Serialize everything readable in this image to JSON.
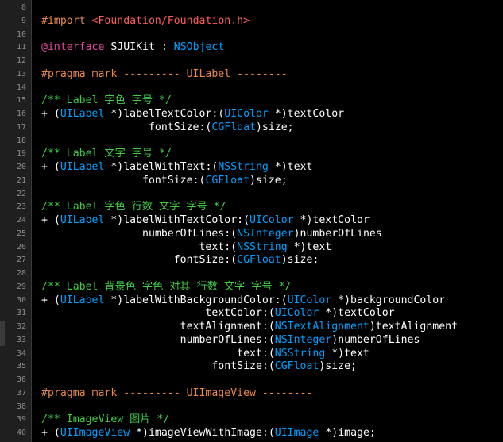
{
  "colors": {
    "background": "#000000",
    "gutter": "#1f1f1f",
    "gutter_text": "#8c8c8c",
    "plain": "#ffffff",
    "comment": "#41cc45",
    "preproc": "#e8884a",
    "string": "#ff5c5c",
    "keyword": "#e64aa0",
    "type": "#00a0ff"
  },
  "lines": [
    {
      "n": "8",
      "tokens": []
    },
    {
      "n": "9",
      "tokens": [
        {
          "t": "#import ",
          "c": "preproc"
        },
        {
          "t": "<Foundation/Foundation.h>",
          "c": "string"
        }
      ]
    },
    {
      "n": "10",
      "tokens": []
    },
    {
      "n": "11",
      "tokens": [
        {
          "t": "@interface",
          "c": "keyword"
        },
        {
          "t": " SJUIKit : ",
          "c": "plain"
        },
        {
          "t": "NSObject",
          "c": "type"
        }
      ]
    },
    {
      "n": "12",
      "tokens": []
    },
    {
      "n": "13",
      "tokens": [
        {
          "t": "#pragma mark --------- UILabel --------",
          "c": "preproc"
        }
      ]
    },
    {
      "n": "14",
      "tokens": []
    },
    {
      "n": "15",
      "tokens": [
        {
          "t": "/** Label 字色 字号 */",
          "c": "comment"
        }
      ]
    },
    {
      "n": "16",
      "tokens": [
        {
          "t": "+ (",
          "c": "plain"
        },
        {
          "t": "UILabel",
          "c": "type"
        },
        {
          "t": " *)labelTextColor:(",
          "c": "plain"
        },
        {
          "t": "UIColor",
          "c": "type"
        },
        {
          "t": " *)textColor",
          "c": "plain"
        }
      ]
    },
    {
      "n": "17",
      "tokens": [
        {
          "t": "                 fontSize:(",
          "c": "plain"
        },
        {
          "t": "CGFloat",
          "c": "type"
        },
        {
          "t": ")size;",
          "c": "plain"
        }
      ]
    },
    {
      "n": "18",
      "tokens": []
    },
    {
      "n": "19",
      "tokens": [
        {
          "t": "/** Label 文字 字号 */",
          "c": "comment"
        }
      ]
    },
    {
      "n": "20",
      "tokens": [
        {
          "t": "+ (",
          "c": "plain"
        },
        {
          "t": "UILabel",
          "c": "type"
        },
        {
          "t": " *)labelWithText:(",
          "c": "plain"
        },
        {
          "t": "NSString",
          "c": "type"
        },
        {
          "t": " *)text",
          "c": "plain"
        }
      ]
    },
    {
      "n": "21",
      "tokens": [
        {
          "t": "                fontSize:(",
          "c": "plain"
        },
        {
          "t": "CGFloat",
          "c": "type"
        },
        {
          "t": ")size;",
          "c": "plain"
        }
      ]
    },
    {
      "n": "22",
      "tokens": []
    },
    {
      "n": "23",
      "tokens": [
        {
          "t": "/** Label 字色 行数 文字 字号 */",
          "c": "comment"
        }
      ]
    },
    {
      "n": "24",
      "tokens": [
        {
          "t": "+ (",
          "c": "plain"
        },
        {
          "t": "UILabel",
          "c": "type"
        },
        {
          "t": " *)labelWithTextColor:(",
          "c": "plain"
        },
        {
          "t": "UIColor",
          "c": "type"
        },
        {
          "t": " *)textColor",
          "c": "plain"
        }
      ]
    },
    {
      "n": "25",
      "tokens": [
        {
          "t": "                numberOfLines:(",
          "c": "plain"
        },
        {
          "t": "NSInteger",
          "c": "type"
        },
        {
          "t": ")numberOfLines",
          "c": "plain"
        }
      ]
    },
    {
      "n": "26",
      "tokens": [
        {
          "t": "                         text:(",
          "c": "plain"
        },
        {
          "t": "NSString",
          "c": "type"
        },
        {
          "t": " *)text",
          "c": "plain"
        }
      ]
    },
    {
      "n": "27",
      "tokens": [
        {
          "t": "                     fontSize:(",
          "c": "plain"
        },
        {
          "t": "CGFloat",
          "c": "type"
        },
        {
          "t": ")size;",
          "c": "plain"
        }
      ]
    },
    {
      "n": "28",
      "tokens": []
    },
    {
      "n": "29",
      "tokens": [
        {
          "t": "/** Label 背景色 字色 对其 行数 文字 字号 */",
          "c": "comment"
        }
      ]
    },
    {
      "n": "30",
      "tokens": [
        {
          "t": "+ (",
          "c": "plain"
        },
        {
          "t": "UILabel",
          "c": "type"
        },
        {
          "t": " *)labelWithBackgroundColor:(",
          "c": "plain"
        },
        {
          "t": "UIColor",
          "c": "type"
        },
        {
          "t": " *)backgroundColor",
          "c": "plain"
        }
      ]
    },
    {
      "n": "31",
      "tokens": [
        {
          "t": "                          textColor:(",
          "c": "plain"
        },
        {
          "t": "UIColor",
          "c": "type"
        },
        {
          "t": " *)textColor",
          "c": "plain"
        }
      ]
    },
    {
      "n": "32",
      "tokens": [
        {
          "t": "                      textAlignment:(",
          "c": "plain"
        },
        {
          "t": "NSTextAlignment",
          "c": "type"
        },
        {
          "t": ")textAlignment",
          "c": "plain"
        }
      ]
    },
    {
      "n": "33",
      "tokens": [
        {
          "t": "                      numberOfLines:(",
          "c": "plain"
        },
        {
          "t": "NSInteger",
          "c": "type"
        },
        {
          "t": ")numberOfLines",
          "c": "plain"
        }
      ]
    },
    {
      "n": "34",
      "tokens": [
        {
          "t": "                               text:(",
          "c": "plain"
        },
        {
          "t": "NSString",
          "c": "type"
        },
        {
          "t": " *)text",
          "c": "plain"
        }
      ]
    },
    {
      "n": "35",
      "tokens": [
        {
          "t": "                           fontSize:(",
          "c": "plain"
        },
        {
          "t": "CGFloat",
          "c": "type"
        },
        {
          "t": ")size;",
          "c": "plain"
        }
      ]
    },
    {
      "n": "36",
      "tokens": []
    },
    {
      "n": "37",
      "tokens": [
        {
          "t": "#pragma mark --------- UIImageView --------",
          "c": "preproc"
        }
      ]
    },
    {
      "n": "38",
      "tokens": []
    },
    {
      "n": "39",
      "tokens": [
        {
          "t": "/** ImageView 图片 */",
          "c": "comment"
        }
      ]
    },
    {
      "n": "40",
      "tokens": [
        {
          "t": "+ (",
          "c": "plain"
        },
        {
          "t": "UIImageView",
          "c": "type"
        },
        {
          "t": " *)imageViewWithImage:(",
          "c": "plain"
        },
        {
          "t": "UIImage",
          "c": "type"
        },
        {
          "t": " *)image;",
          "c": "plain"
        }
      ]
    }
  ]
}
